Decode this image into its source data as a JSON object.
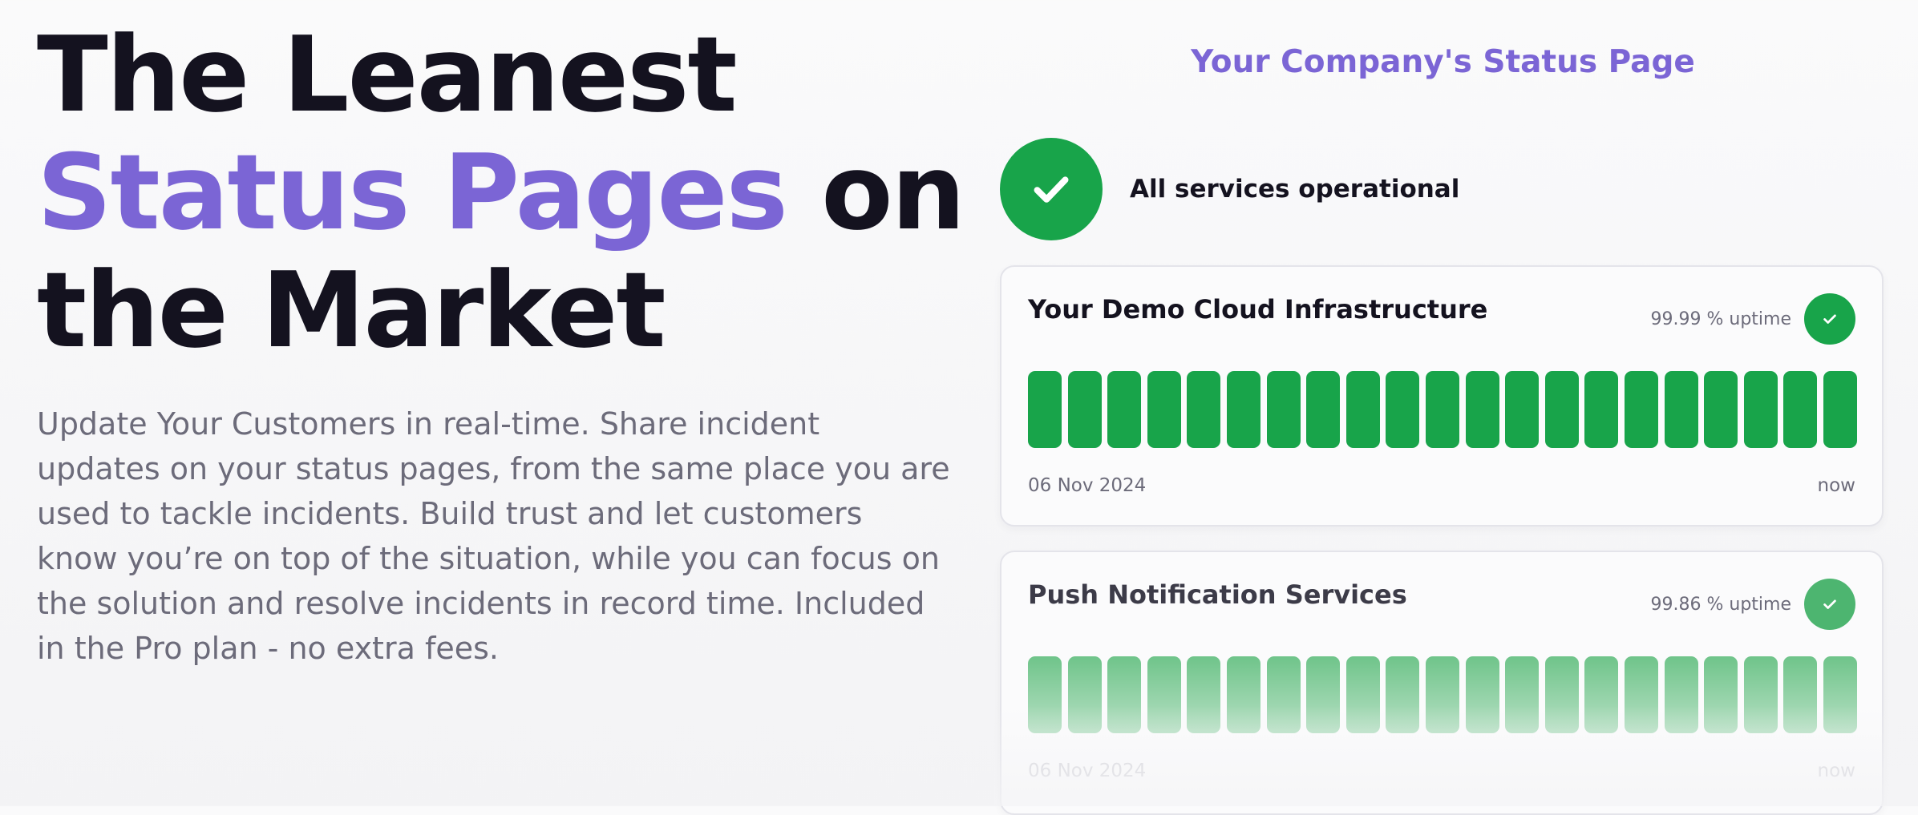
{
  "hero": {
    "title_line1": "The Leanest",
    "title_accent": "Status Pages",
    "title_line2_rest": "on",
    "title_line3": "the Market",
    "description": "Update Your Customers in real-time. Share incident updates on your status pages, from the same place you are used to tackle incidents. Build trust and let customers know you’re on top of the situation, while you can focus on the solution and resolve incidents in record time. Included in the Pro plan - no extra fees."
  },
  "status_page": {
    "heading": "Your Company's Status Page",
    "overall_status": "All services operational",
    "overall_icon": "check-icon",
    "services": [
      {
        "name": "Your Demo Cloud Infrastructure",
        "uptime": "99.99 % uptime",
        "bar_count": 21,
        "bar_status": "operational",
        "start_date": "06 Nov 2024",
        "end_label": "now"
      },
      {
        "name": "Push Notification Services",
        "uptime": "99.86 % uptime",
        "bar_count": 21,
        "bar_status": "operational",
        "start_date": "06 Nov 2024",
        "end_label": "now"
      }
    ]
  },
  "colors": {
    "accent": "#7b65d5",
    "operational": "#18a44a",
    "text_dark": "#14121f",
    "text_muted": "#6c6b7a"
  }
}
